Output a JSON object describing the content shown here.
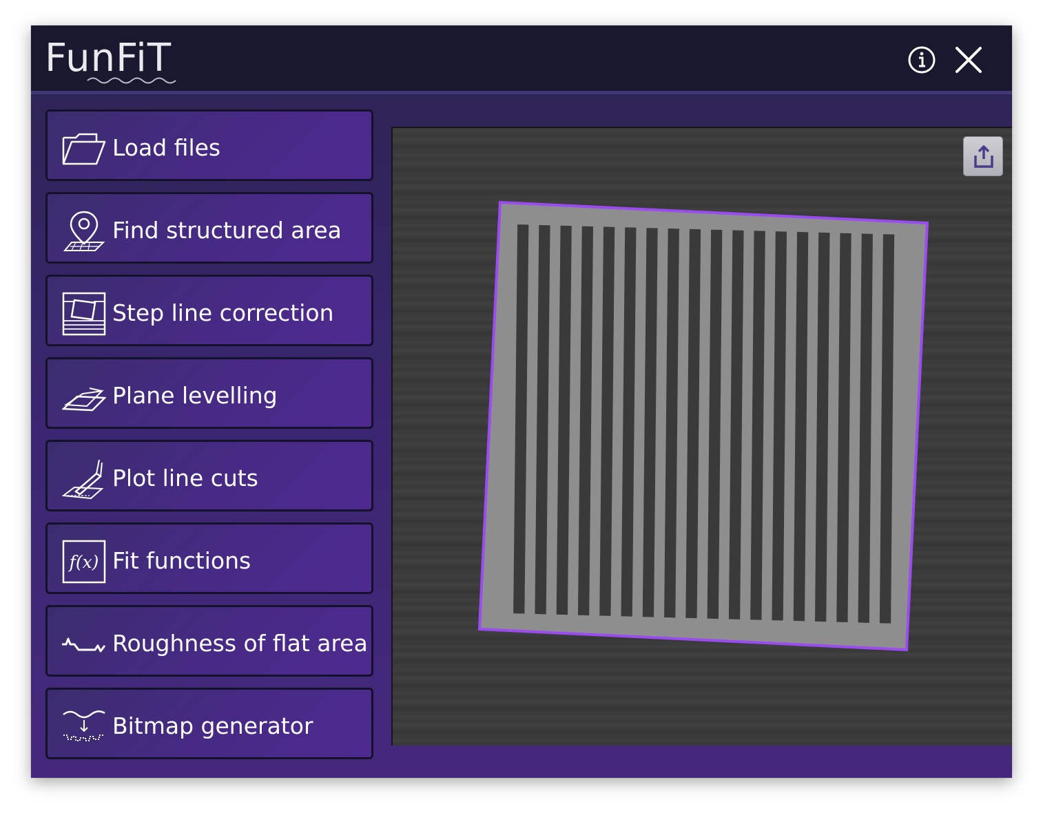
{
  "app": {
    "title": "FunFiT"
  },
  "titlebar": {
    "info_icon": "info-circle-icon",
    "close_icon": "close-icon"
  },
  "sidebar": {
    "items": [
      {
        "label": "Load files",
        "icon": "folder-icon"
      },
      {
        "label": "Find structured area",
        "icon": "map-pin-icon"
      },
      {
        "label": "Step line correction",
        "icon": "step-line-icon"
      },
      {
        "label": "Plane levelling",
        "icon": "plane-icon"
      },
      {
        "label": "Plot line cuts",
        "icon": "line-cut-icon"
      },
      {
        "label": "Fit functions",
        "icon": "function-icon"
      },
      {
        "label": "Roughness of flat area",
        "icon": "roughness-icon"
      },
      {
        "label": "Bitmap generator",
        "icon": "bitmap-icon"
      }
    ]
  },
  "viewer": {
    "export_icon": "share-export-icon",
    "selection_color": "#9a4cf0"
  },
  "colors": {
    "titlebar_bg": "#19182e",
    "panel_bg": "#3a2670",
    "button_bg": "#472a85",
    "accent": "#9a4cf0"
  }
}
